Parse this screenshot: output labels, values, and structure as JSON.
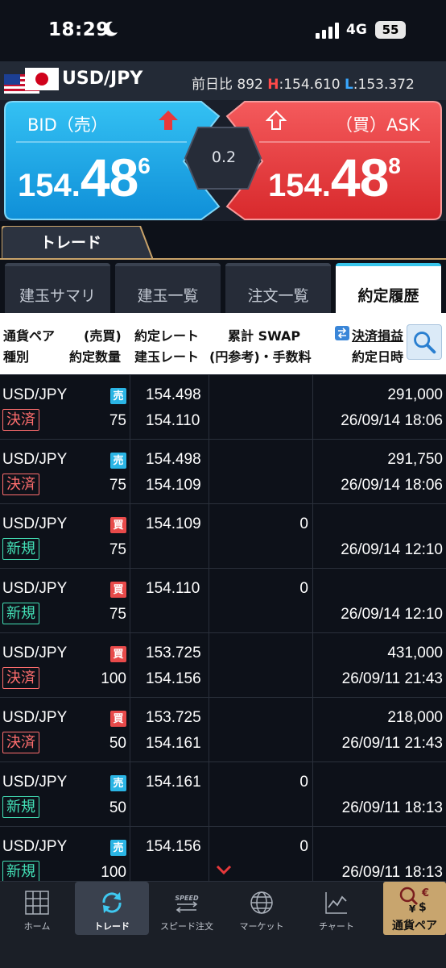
{
  "status": {
    "time": "18:29",
    "network": "4G",
    "battery": "55"
  },
  "pair_header": {
    "pair": "USD/JPY",
    "change_label": "前日比",
    "change_value": "892",
    "high_label": "H",
    "high_value": ":154.610",
    "low_label": "L",
    "low_value": ":153.372"
  },
  "bid": {
    "label": "BID（売）",
    "price_small": "154.",
    "price_big": "48",
    "price_sup": "6"
  },
  "ask": {
    "label": "（買）ASK",
    "price_small": "154.",
    "price_big": "48",
    "price_sup": "8"
  },
  "spread": "0.2",
  "trade_tab": "トレード",
  "sub_tabs": [
    "建玉サマリ",
    "建玉一覧",
    "注文一覧",
    "約定履歴"
  ],
  "columns": {
    "c1a": "通貨ペア",
    "c1b": "(売買)",
    "c2a": "種別",
    "c2b": "約定数量",
    "c3a": "約定レート",
    "c3b": "建玉レート",
    "c4a": "累計 SWAP",
    "c4b": "(円参考)・手数料",
    "c5a": "決済損益",
    "c5b": "約定日時"
  },
  "rows": [
    {
      "pair": "USD/JPY",
      "side": "売",
      "type": "決済",
      "qty": "75",
      "rate": "154.498",
      "open_rate": "154.110",
      "swap": "",
      "pnl": "291,000",
      "datetime": "26/09/14 18:06"
    },
    {
      "pair": "USD/JPY",
      "side": "売",
      "type": "決済",
      "qty": "75",
      "rate": "154.498",
      "open_rate": "154.109",
      "swap": "",
      "pnl": "291,750",
      "datetime": "26/09/14 18:06"
    },
    {
      "pair": "USD/JPY",
      "side": "買",
      "type": "新規",
      "qty": "75",
      "rate": "154.109",
      "open_rate": "",
      "swap": "0",
      "pnl": "",
      "datetime": "26/09/14 12:10"
    },
    {
      "pair": "USD/JPY",
      "side": "買",
      "type": "新規",
      "qty": "75",
      "rate": "154.110",
      "open_rate": "",
      "swap": "0",
      "pnl": "",
      "datetime": "26/09/14 12:10"
    },
    {
      "pair": "USD/JPY",
      "side": "買",
      "type": "決済",
      "qty": "100",
      "rate": "153.725",
      "open_rate": "154.156",
      "swap": "",
      "pnl": "431,000",
      "datetime": "26/09/11 21:43"
    },
    {
      "pair": "USD/JPY",
      "side": "買",
      "type": "決済",
      "qty": "50",
      "rate": "153.725",
      "open_rate": "154.161",
      "swap": "",
      "pnl": "218,000",
      "datetime": "26/09/11 21:43"
    },
    {
      "pair": "USD/JPY",
      "side": "売",
      "type": "新規",
      "qty": "50",
      "rate": "154.161",
      "open_rate": "",
      "swap": "0",
      "pnl": "",
      "datetime": "26/09/11 18:13"
    },
    {
      "pair": "USD/JPY",
      "side": "売",
      "type": "新規",
      "qty": "100",
      "rate": "154.156",
      "open_rate": "",
      "swap": "0",
      "pnl": "",
      "datetime": "26/09/11 18:13"
    }
  ],
  "nav": [
    {
      "label": "ホーム",
      "icon": "home-grid-icon"
    },
    {
      "label": "トレード",
      "icon": "trade-refresh-icon"
    },
    {
      "label": "スピード注文",
      "icon": "speed-order-icon"
    },
    {
      "label": "マーケット",
      "icon": "globe-icon"
    },
    {
      "label": "チャート",
      "icon": "chart-icon"
    },
    {
      "label": "通貨ペア",
      "icon": "currency-pair-icon"
    }
  ],
  "colors": {
    "bid": "#1ea6e6",
    "ask": "#e8393b",
    "accent": "#c8a56e",
    "new_type": "#43e0b6",
    "close_type": "#ff6e6e"
  }
}
